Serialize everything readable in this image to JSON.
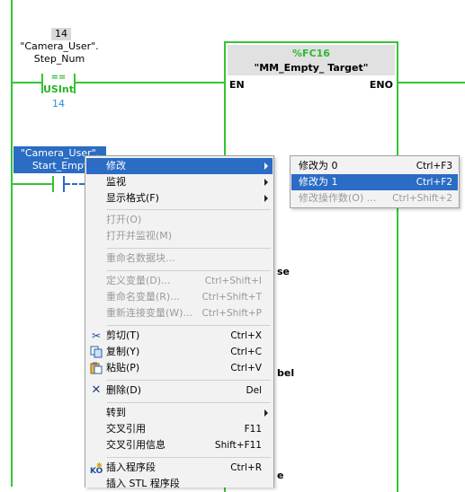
{
  "operand_top": {
    "address_number": "14",
    "tag_line1": "\"Camera_User\".",
    "tag_line2": "Step_Num",
    "compare_op": "==",
    "compare_type": "USInt",
    "compare_value": "14"
  },
  "function_block": {
    "name": "%FC16",
    "title": "\"MM_Empty_ Target\"",
    "pin_en": "EN",
    "pin_eno": "ENO",
    "partial_label_1": "se",
    "partial_label_2": "bel",
    "partial_label_3": "e"
  },
  "selected_operand": {
    "line1": "\"Camera_User\".",
    "line2": "Start_Empt"
  },
  "context_menu": {
    "items": [
      {
        "label": "修改",
        "shortcut": "",
        "submenu": true
      },
      {
        "label": "监视",
        "shortcut": "",
        "submenu": true
      },
      {
        "label": "显示格式(F)",
        "shortcut": "",
        "submenu": true
      },
      {
        "label": "打开(O)",
        "shortcut": ""
      },
      {
        "label": "打开并监视(M)",
        "shortcut": ""
      },
      {
        "label": "重命名数据块...",
        "shortcut": ""
      },
      {
        "label": "定义变量(D)...",
        "shortcut": "Ctrl+Shift+I"
      },
      {
        "label": "重命名变量(R)...",
        "shortcut": "Ctrl+Shift+T"
      },
      {
        "label": "重新连接变量(W)...",
        "shortcut": "Ctrl+Shift+P"
      },
      {
        "label": "剪切(T)",
        "shortcut": "Ctrl+X"
      },
      {
        "label": "复制(Y)",
        "shortcut": "Ctrl+C"
      },
      {
        "label": "粘贴(P)",
        "shortcut": "Ctrl+V"
      },
      {
        "label": "删除(D)",
        "shortcut": "Del"
      },
      {
        "label": "转到",
        "shortcut": "",
        "submenu": true
      },
      {
        "label": "交叉引用",
        "shortcut": "F11"
      },
      {
        "label": "交叉引用信息",
        "shortcut": "Shift+F11"
      },
      {
        "label": "插入程序段",
        "shortcut": "Ctrl+R"
      },
      {
        "label": "插入 STL 程序段",
        "shortcut": ""
      }
    ]
  },
  "submenu": {
    "items": [
      {
        "label": "修改为 0",
        "shortcut": "Ctrl+F3"
      },
      {
        "label": "修改为 1",
        "shortcut": "Ctrl+F2"
      },
      {
        "label": "修改操作数(O) ...",
        "shortcut": "Ctrl+Shift+2"
      }
    ]
  },
  "colors": {
    "rail_green": "#35c435",
    "selection_blue": "#2b6cc4",
    "menu_bg": "#f2f2f2",
    "value_blue": "#2a8fd6"
  }
}
